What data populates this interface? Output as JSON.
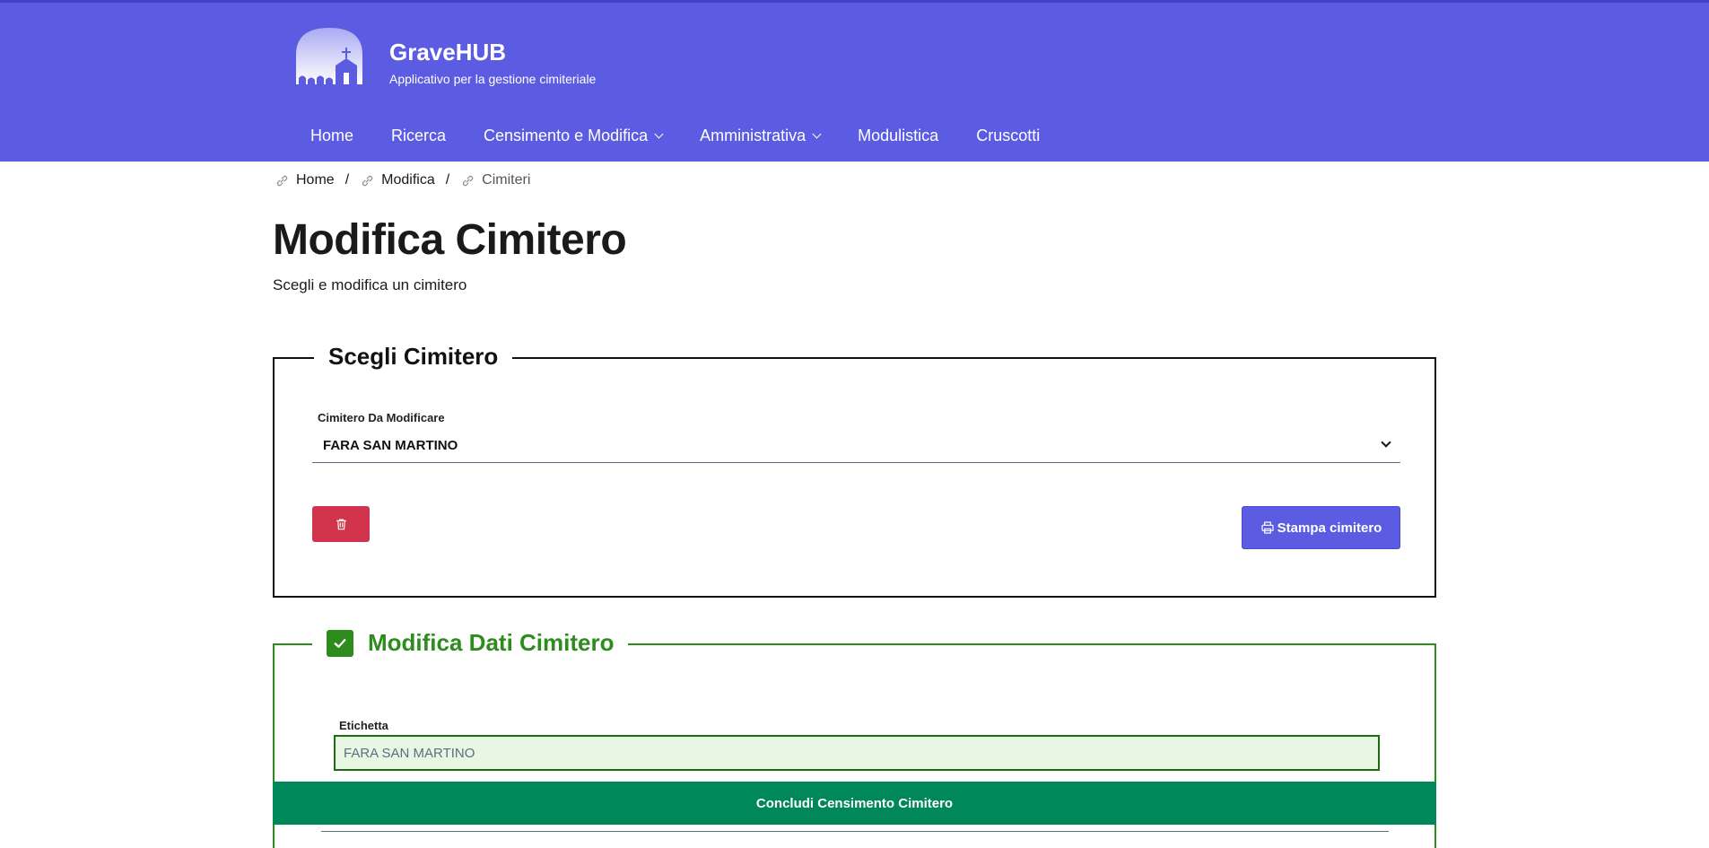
{
  "brand": {
    "title": "GraveHUB",
    "subtitle": "Applicativo per la gestione cimiteriale"
  },
  "nav": {
    "items": [
      {
        "label": "Home",
        "dropdown": false
      },
      {
        "label": "Ricerca",
        "dropdown": false
      },
      {
        "label": "Censimento e Modifica",
        "dropdown": true
      },
      {
        "label": "Amministrativa",
        "dropdown": true
      },
      {
        "label": "Modulistica",
        "dropdown": false
      },
      {
        "label": "Cruscotti",
        "dropdown": false
      }
    ]
  },
  "breadcrumb": {
    "items": [
      "Home",
      "Modifica",
      "Cimiteri"
    ],
    "separator": "/",
    "icon": "link-icon"
  },
  "page": {
    "title": "Modifica Cimitero",
    "subtitle": "Scegli e modifica un cimitero"
  },
  "choose_section": {
    "legend": "Scegli Cimitero",
    "select_label": "Cimitero Da Modificare",
    "select_value": "FARA SAN MARTINO",
    "delete_icon": "trash-icon",
    "print_label": "Stampa cimitero",
    "print_icon": "printer-icon"
  },
  "edit_section": {
    "legend": "Modifica Dati Cimitero",
    "legend_icon": "check-icon",
    "field_label": "Etichetta",
    "field_value": "FARA SAN MARTINO",
    "conclude_label": "Concludi Censimento Cimitero"
  },
  "colors": {
    "header": "#5b5ce2",
    "danger": "#d1344c",
    "success_border": "#2e8b1e",
    "conclude": "#00875a",
    "input_bg": "#e8f7e3"
  }
}
